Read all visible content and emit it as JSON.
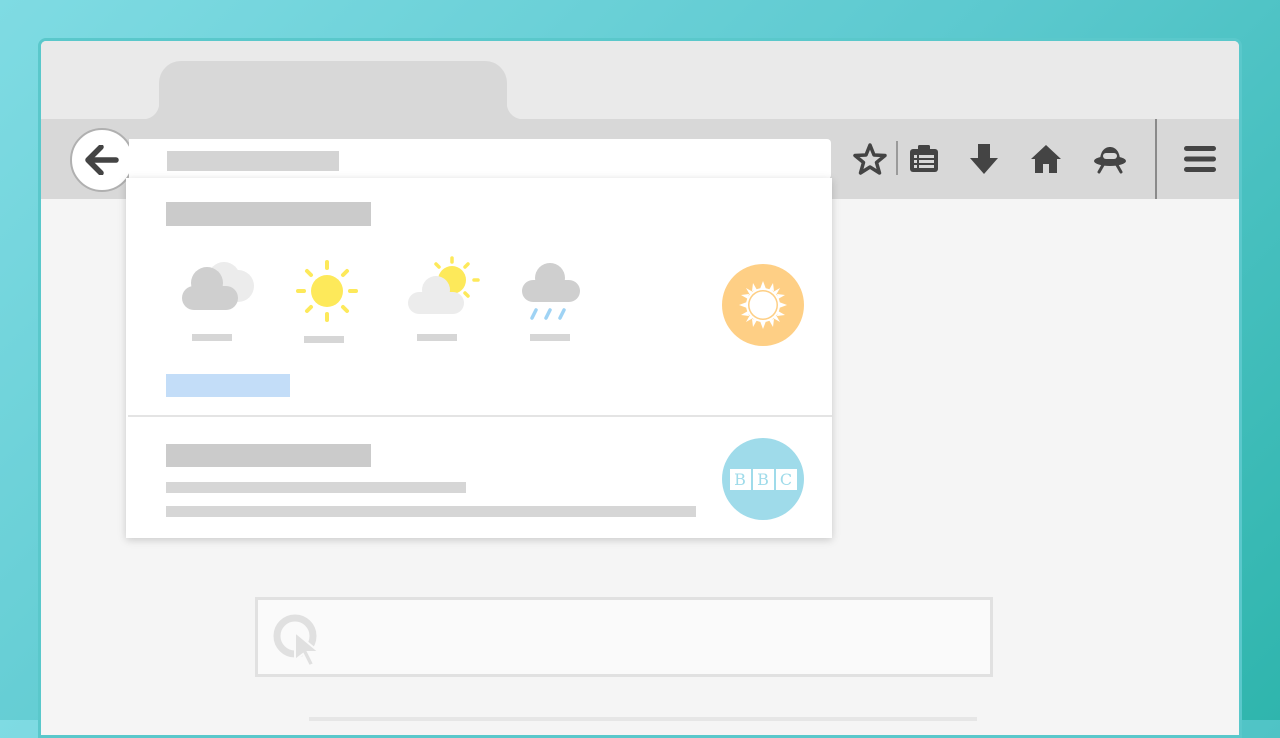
{
  "window": {
    "background": "#f5f5f5",
    "frame_color": "#5ac8cb"
  },
  "toolbar": {
    "back_icon": "back-arrow-icon",
    "bookmark_icon": "star-icon",
    "reading_list_icon": "reading-list-icon",
    "downloads_icon": "download-icon",
    "home_icon": "home-icon",
    "pocket_icon": "ufo-icon",
    "menu_icon": "hamburger-menu-icon"
  },
  "dropdown": {
    "weather_icons": [
      "cloudy-icon",
      "sunny-icon",
      "partly-sunny-icon",
      "rain-icon"
    ],
    "weather_badge_color": "#fecf85",
    "link_color": "#c3ddf8",
    "news_badge": {
      "letters": [
        "B",
        "B",
        "C"
      ],
      "color": "#9fdbea"
    }
  },
  "search": {
    "icon": "cursor-search-icon"
  }
}
